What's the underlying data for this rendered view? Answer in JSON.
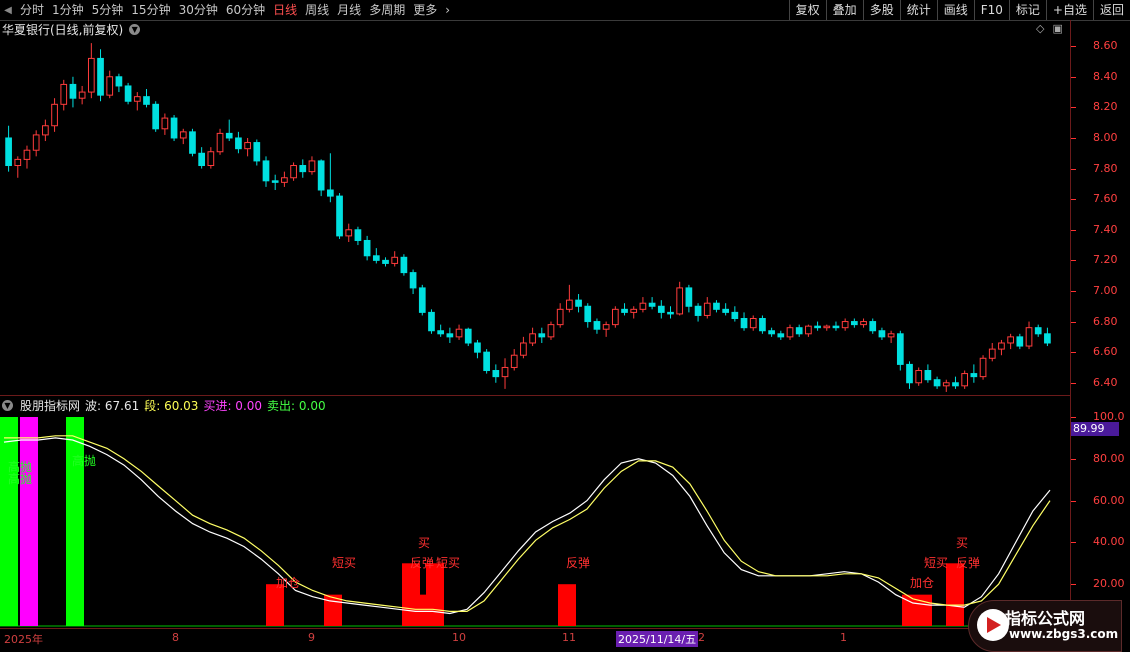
{
  "toolbar": {
    "periods": [
      "分时",
      "1分钟",
      "5分钟",
      "15分钟",
      "30分钟",
      "60分钟",
      "日线",
      "周线",
      "月线",
      "多周期",
      "更多"
    ],
    "active_period": "日线",
    "right_buttons": [
      "复权",
      "叠加",
      "多股",
      "统计",
      "画线",
      "F10",
      "标记",
      "+自选",
      "返回"
    ]
  },
  "main_panel": {
    "title": "华夏银行(日线,前复权)",
    "axis_labels": [
      "8.60",
      "8.40",
      "8.20",
      "8.00",
      "7.80",
      "7.60",
      "7.40",
      "7.20",
      "7.00",
      "6.80",
      "6.60",
      "6.40"
    ]
  },
  "indicator_panel": {
    "name": "股朋指标网",
    "bo_label": "波: 67.61",
    "duan_label": "段: 60.03",
    "buy_label": "买进: 0.00",
    "sell_label": "卖出: 0.00",
    "axis_labels": [
      "100.0",
      "80.00",
      "60.00",
      "40.00",
      "20.00"
    ],
    "current_value": "89.99"
  },
  "signals": {
    "top_left": [
      {
        "text": "高抛"
      },
      {
        "text": "高抛"
      },
      {
        "text": "高抛"
      }
    ],
    "jiacang_1": "加仓",
    "duanmai_1": "短买",
    "mai_1": "买",
    "fantan_1": "反弹",
    "duanmai_2": "短买",
    "fantan_2": "反弹",
    "jiacang_2": "加仓",
    "duanmai_3": "短买",
    "mai_2": "买",
    "fantan_3": "反弹"
  },
  "date_axis": {
    "labels": [
      "2025年",
      "8",
      "9",
      "10",
      "11",
      "2",
      "1"
    ],
    "highlight": "2025/11/14/五"
  },
  "watermark": {
    "title": "指标公式网",
    "url": "www.zbgs3.com"
  },
  "colors": {
    "up": "#ff3c3c",
    "down": "#00e0e0",
    "line": "#ffff66",
    "buy_bar": "#ff0000",
    "sell_bar_green": "#00ff00",
    "sell_bar_magenta": "#ff00ff",
    "background": "#000000"
  },
  "chart_data": {
    "type": "candlestick",
    "title": "华夏银行(日线,前复权)",
    "ylim": [
      6.32,
      8.66
    ],
    "candles": [
      {
        "o": 8.0,
        "h": 8.08,
        "l": 7.78,
        "c": 7.82
      },
      {
        "o": 7.82,
        "h": 7.88,
        "l": 7.74,
        "c": 7.86
      },
      {
        "o": 7.86,
        "h": 7.95,
        "l": 7.8,
        "c": 7.92
      },
      {
        "o": 7.92,
        "h": 8.05,
        "l": 7.88,
        "c": 8.02
      },
      {
        "o": 8.02,
        "h": 8.12,
        "l": 7.98,
        "c": 8.08
      },
      {
        "o": 8.08,
        "h": 8.26,
        "l": 8.04,
        "c": 8.22
      },
      {
        "o": 8.22,
        "h": 8.38,
        "l": 8.18,
        "c": 8.35
      },
      {
        "o": 8.35,
        "h": 8.4,
        "l": 8.2,
        "c": 8.26
      },
      {
        "o": 8.26,
        "h": 8.34,
        "l": 8.22,
        "c": 8.3
      },
      {
        "o": 8.3,
        "h": 8.62,
        "l": 8.26,
        "c": 8.52
      },
      {
        "o": 8.52,
        "h": 8.58,
        "l": 8.24,
        "c": 8.28
      },
      {
        "o": 8.28,
        "h": 8.44,
        "l": 8.26,
        "c": 8.4
      },
      {
        "o": 8.4,
        "h": 8.42,
        "l": 8.3,
        "c": 8.34
      },
      {
        "o": 8.34,
        "h": 8.36,
        "l": 8.22,
        "c": 8.24
      },
      {
        "o": 8.24,
        "h": 8.3,
        "l": 8.18,
        "c": 8.27
      },
      {
        "o": 8.27,
        "h": 8.32,
        "l": 8.2,
        "c": 8.22
      },
      {
        "o": 8.22,
        "h": 8.24,
        "l": 8.04,
        "c": 8.06
      },
      {
        "o": 8.06,
        "h": 8.16,
        "l": 8.02,
        "c": 8.13
      },
      {
        "o": 8.13,
        "h": 8.15,
        "l": 7.98,
        "c": 8.0
      },
      {
        "o": 8.0,
        "h": 8.06,
        "l": 7.96,
        "c": 8.04
      },
      {
        "o": 8.04,
        "h": 8.06,
        "l": 7.88,
        "c": 7.9
      },
      {
        "o": 7.9,
        "h": 7.94,
        "l": 7.8,
        "c": 7.82
      },
      {
        "o": 7.82,
        "h": 7.94,
        "l": 7.8,
        "c": 7.91
      },
      {
        "o": 7.91,
        "h": 8.06,
        "l": 7.89,
        "c": 8.03
      },
      {
        "o": 8.03,
        "h": 8.12,
        "l": 7.98,
        "c": 8.0
      },
      {
        "o": 8.0,
        "h": 8.04,
        "l": 7.9,
        "c": 7.93
      },
      {
        "o": 7.93,
        "h": 8.0,
        "l": 7.88,
        "c": 7.97
      },
      {
        "o": 7.97,
        "h": 7.99,
        "l": 7.82,
        "c": 7.85
      },
      {
        "o": 7.85,
        "h": 7.88,
        "l": 7.68,
        "c": 7.72
      },
      {
        "o": 7.72,
        "h": 7.76,
        "l": 7.66,
        "c": 7.71
      },
      {
        "o": 7.71,
        "h": 7.78,
        "l": 7.68,
        "c": 7.74
      },
      {
        "o": 7.74,
        "h": 7.84,
        "l": 7.72,
        "c": 7.82
      },
      {
        "o": 7.82,
        "h": 7.86,
        "l": 7.74,
        "c": 7.78
      },
      {
        "o": 7.78,
        "h": 7.88,
        "l": 7.76,
        "c": 7.85
      },
      {
        "o": 7.85,
        "h": 7.86,
        "l": 7.62,
        "c": 7.66
      },
      {
        "o": 7.66,
        "h": 7.9,
        "l": 7.58,
        "c": 7.62
      },
      {
        "o": 7.62,
        "h": 7.64,
        "l": 7.34,
        "c": 7.36
      },
      {
        "o": 7.36,
        "h": 7.44,
        "l": 7.32,
        "c": 7.4
      },
      {
        "o": 7.4,
        "h": 7.42,
        "l": 7.3,
        "c": 7.33
      },
      {
        "o": 7.33,
        "h": 7.36,
        "l": 7.2,
        "c": 7.23
      },
      {
        "o": 7.23,
        "h": 7.28,
        "l": 7.18,
        "c": 7.2
      },
      {
        "o": 7.2,
        "h": 7.22,
        "l": 7.16,
        "c": 7.18
      },
      {
        "o": 7.18,
        "h": 7.26,
        "l": 7.16,
        "c": 7.22
      },
      {
        "o": 7.22,
        "h": 7.24,
        "l": 7.1,
        "c": 7.12
      },
      {
        "o": 7.12,
        "h": 7.14,
        "l": 6.98,
        "c": 7.02
      },
      {
        "o": 7.02,
        "h": 7.04,
        "l": 6.84,
        "c": 6.86
      },
      {
        "o": 6.86,
        "h": 6.88,
        "l": 6.72,
        "c": 6.74
      },
      {
        "o": 6.74,
        "h": 6.78,
        "l": 6.7,
        "c": 6.72
      },
      {
        "o": 6.72,
        "h": 6.76,
        "l": 6.66,
        "c": 6.7
      },
      {
        "o": 6.7,
        "h": 6.78,
        "l": 6.68,
        "c": 6.75
      },
      {
        "o": 6.75,
        "h": 6.76,
        "l": 6.64,
        "c": 6.66
      },
      {
        "o": 6.66,
        "h": 6.68,
        "l": 6.56,
        "c": 6.6
      },
      {
        "o": 6.6,
        "h": 6.62,
        "l": 6.46,
        "c": 6.48
      },
      {
        "o": 6.48,
        "h": 6.52,
        "l": 6.4,
        "c": 6.44
      },
      {
        "o": 6.44,
        "h": 6.56,
        "l": 6.36,
        "c": 6.5
      },
      {
        "o": 6.5,
        "h": 6.62,
        "l": 6.48,
        "c": 6.58
      },
      {
        "o": 6.58,
        "h": 6.7,
        "l": 6.56,
        "c": 6.66
      },
      {
        "o": 6.66,
        "h": 6.76,
        "l": 6.64,
        "c": 6.72
      },
      {
        "o": 6.72,
        "h": 6.76,
        "l": 6.66,
        "c": 6.7
      },
      {
        "o": 6.7,
        "h": 6.8,
        "l": 6.68,
        "c": 6.78
      },
      {
        "o": 6.78,
        "h": 6.92,
        "l": 6.76,
        "c": 6.88
      },
      {
        "o": 6.88,
        "h": 7.04,
        "l": 6.86,
        "c": 6.94
      },
      {
        "o": 6.94,
        "h": 6.98,
        "l": 6.86,
        "c": 6.9
      },
      {
        "o": 6.9,
        "h": 6.92,
        "l": 6.76,
        "c": 6.8
      },
      {
        "o": 6.8,
        "h": 6.82,
        "l": 6.72,
        "c": 6.75
      },
      {
        "o": 6.75,
        "h": 6.8,
        "l": 6.7,
        "c": 6.78
      },
      {
        "o": 6.78,
        "h": 6.9,
        "l": 6.76,
        "c": 6.88
      },
      {
        "o": 6.88,
        "h": 6.92,
        "l": 6.84,
        "c": 6.86
      },
      {
        "o": 6.86,
        "h": 6.9,
        "l": 6.82,
        "c": 6.88
      },
      {
        "o": 6.88,
        "h": 6.96,
        "l": 6.86,
        "c": 6.92
      },
      {
        "o": 6.92,
        "h": 6.96,
        "l": 6.88,
        "c": 6.9
      },
      {
        "o": 6.9,
        "h": 6.94,
        "l": 6.82,
        "c": 6.86
      },
      {
        "o": 6.86,
        "h": 6.9,
        "l": 6.82,
        "c": 6.85
      },
      {
        "o": 6.85,
        "h": 7.06,
        "l": 6.84,
        "c": 7.02
      },
      {
        "o": 7.02,
        "h": 7.04,
        "l": 6.86,
        "c": 6.9
      },
      {
        "o": 6.9,
        "h": 6.92,
        "l": 6.8,
        "c": 6.84
      },
      {
        "o": 6.84,
        "h": 6.96,
        "l": 6.82,
        "c": 6.92
      },
      {
        "o": 6.92,
        "h": 6.94,
        "l": 6.86,
        "c": 6.88
      },
      {
        "o": 6.88,
        "h": 6.92,
        "l": 6.84,
        "c": 6.86
      },
      {
        "o": 6.86,
        "h": 6.9,
        "l": 6.8,
        "c": 6.82
      },
      {
        "o": 6.82,
        "h": 6.86,
        "l": 6.74,
        "c": 6.76
      },
      {
        "o": 6.76,
        "h": 6.84,
        "l": 6.74,
        "c": 6.82
      },
      {
        "o": 6.82,
        "h": 6.84,
        "l": 6.72,
        "c": 6.74
      },
      {
        "o": 6.74,
        "h": 6.76,
        "l": 6.7,
        "c": 6.72
      },
      {
        "o": 6.72,
        "h": 6.74,
        "l": 6.68,
        "c": 6.7
      },
      {
        "o": 6.7,
        "h": 6.78,
        "l": 6.68,
        "c": 6.76
      },
      {
        "o": 6.76,
        "h": 6.78,
        "l": 6.7,
        "c": 6.72
      },
      {
        "o": 6.72,
        "h": 6.78,
        "l": 6.7,
        "c": 6.77
      },
      {
        "o": 6.77,
        "h": 6.8,
        "l": 6.74,
        "c": 6.76
      },
      {
        "o": 6.76,
        "h": 6.78,
        "l": 6.74,
        "c": 6.77
      },
      {
        "o": 6.77,
        "h": 6.8,
        "l": 6.74,
        "c": 6.76
      },
      {
        "o": 6.76,
        "h": 6.82,
        "l": 6.74,
        "c": 6.8
      },
      {
        "o": 6.8,
        "h": 6.82,
        "l": 6.76,
        "c": 6.78
      },
      {
        "o": 6.78,
        "h": 6.82,
        "l": 6.76,
        "c": 6.8
      },
      {
        "o": 6.8,
        "h": 6.82,
        "l": 6.72,
        "c": 6.74
      },
      {
        "o": 6.74,
        "h": 6.76,
        "l": 6.68,
        "c": 6.7
      },
      {
        "o": 6.7,
        "h": 6.74,
        "l": 6.66,
        "c": 6.72
      },
      {
        "o": 6.72,
        "h": 6.74,
        "l": 6.48,
        "c": 6.52
      },
      {
        "o": 6.52,
        "h": 6.54,
        "l": 6.36,
        "c": 6.4
      },
      {
        "o": 6.4,
        "h": 6.5,
        "l": 6.38,
        "c": 6.48
      },
      {
        "o": 6.48,
        "h": 6.52,
        "l": 6.4,
        "c": 6.42
      },
      {
        "o": 6.42,
        "h": 6.44,
        "l": 6.36,
        "c": 6.38
      },
      {
        "o": 6.38,
        "h": 6.42,
        "l": 6.34,
        "c": 6.4
      },
      {
        "o": 6.4,
        "h": 6.44,
        "l": 6.36,
        "c": 6.38
      },
      {
        "o": 6.38,
        "h": 6.48,
        "l": 6.36,
        "c": 6.46
      },
      {
        "o": 6.46,
        "h": 6.52,
        "l": 6.4,
        "c": 6.44
      },
      {
        "o": 6.44,
        "h": 6.58,
        "l": 6.42,
        "c": 6.56
      },
      {
        "o": 6.56,
        "h": 6.66,
        "l": 6.54,
        "c": 6.62
      },
      {
        "o": 6.62,
        "h": 6.68,
        "l": 6.58,
        "c": 6.66
      },
      {
        "o": 6.66,
        "h": 6.72,
        "l": 6.62,
        "c": 6.7
      },
      {
        "o": 6.7,
        "h": 6.72,
        "l": 6.62,
        "c": 6.64
      },
      {
        "o": 6.64,
        "h": 6.8,
        "l": 6.62,
        "c": 6.76
      },
      {
        "o": 6.76,
        "h": 6.78,
        "l": 6.7,
        "c": 6.72
      },
      {
        "o": 6.72,
        "h": 6.76,
        "l": 6.64,
        "c": 6.66
      }
    ]
  },
  "indicator_data": {
    "type": "line",
    "ylim": [
      0,
      100
    ],
    "series": [
      {
        "name": "波",
        "values": [
          88,
          89,
          89,
          90,
          89,
          86,
          82,
          77,
          70,
          62,
          55,
          49,
          45,
          42,
          38,
          32,
          25,
          17,
          14,
          12,
          11,
          10,
          9,
          8,
          7,
          7,
          6,
          8,
          16,
          26,
          36,
          45,
          50,
          54,
          60,
          70,
          78,
          80,
          78,
          72,
          62,
          48,
          35,
          27,
          24,
          24,
          24,
          24,
          25,
          26,
          25,
          21,
          15,
          11,
          10,
          10,
          9,
          14,
          25,
          40,
          55,
          65
        ]
      },
      {
        "name": "段",
        "values": [
          90,
          90,
          90,
          91,
          91,
          88,
          85,
          80,
          74,
          67,
          60,
          53,
          49,
          46,
          42,
          36,
          29,
          21,
          17,
          14,
          12,
          11,
          10,
          9,
          8,
          8,
          7,
          7,
          12,
          22,
          32,
          41,
          47,
          51,
          56,
          66,
          74,
          79,
          79,
          76,
          68,
          55,
          41,
          31,
          26,
          24,
          24,
          24,
          24,
          25,
          25,
          23,
          18,
          13,
          11,
          10,
          10,
          12,
          20,
          34,
          48,
          60
        ]
      }
    ],
    "signal_bars": [
      {
        "color": "green",
        "value": 100
      },
      {
        "color": "magenta",
        "value": 100
      },
      {
        "color": "green",
        "value": 100
      },
      {
        "color": "red",
        "value": 20
      },
      {
        "color": "red",
        "value": 15
      },
      {
        "color": "red",
        "value": 30
      },
      {
        "color": "red",
        "value": 15
      },
      {
        "color": "red",
        "value": 30
      },
      {
        "color": "red",
        "value": 20
      },
      {
        "color": "red",
        "value": 15
      },
      {
        "color": "red",
        "value": 30
      }
    ]
  }
}
